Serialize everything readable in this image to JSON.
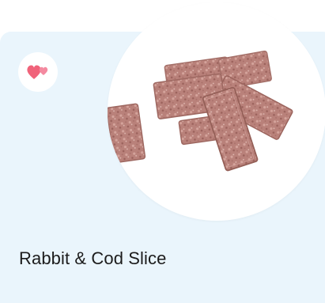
{
  "product": {
    "title": "Rabbit & Cod Slice",
    "image_alt": "Rabbit & Cod Slice treats"
  },
  "favorite": {
    "icon": "hearts-icon",
    "color": "#f0637a"
  },
  "colors": {
    "card_background": "#eaf5fc",
    "title_text": "#1c1c1c"
  }
}
